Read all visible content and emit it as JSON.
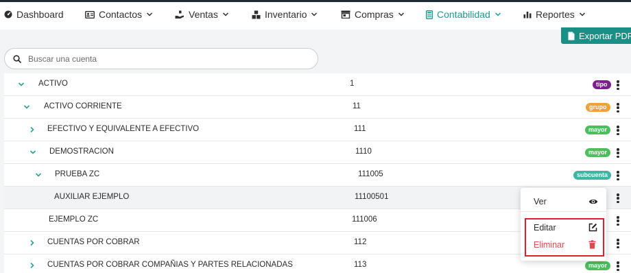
{
  "nav": {
    "items": [
      {
        "label": "Dashboard",
        "icon": "dashboard-icon",
        "has_menu": false,
        "active": false
      },
      {
        "label": "Contactos",
        "icon": "contacts-card-icon",
        "has_menu": true,
        "active": false
      },
      {
        "label": "Ventas",
        "icon": "sales-hand-icon",
        "has_menu": true,
        "active": false
      },
      {
        "label": "Inventario",
        "icon": "boxes-icon",
        "has_menu": true,
        "active": false
      },
      {
        "label": "Compras",
        "icon": "store-icon",
        "has_menu": true,
        "active": false
      },
      {
        "label": "Contabilidad",
        "icon": "calculator-icon",
        "has_menu": true,
        "active": true
      },
      {
        "label": "Reportes",
        "icon": "bar-chart-icon",
        "has_menu": true,
        "active": false
      }
    ]
  },
  "toolbar": {
    "export_label": "Exportar PDF",
    "search_placeholder": "Buscar una cuenta"
  },
  "accounts": [
    {
      "name": "ACTIVO",
      "code": "1",
      "badge": "tipo",
      "expandable": true,
      "expanded": true
    },
    {
      "name": "ACTIVO CORRIENTE",
      "code": "11",
      "badge": "grupo",
      "expandable": true,
      "expanded": true
    },
    {
      "name": "EFECTIVO Y EQUIVALENTE A EFECTIVO",
      "code": "111",
      "badge": "mayor",
      "expandable": true,
      "expanded": false
    },
    {
      "name": "DEMOSTRACION",
      "code": "1110",
      "badge": "mayor",
      "expandable": true,
      "expanded": true
    },
    {
      "name": "PRUEBA ZC",
      "code": "111005",
      "badge": "subcuenta",
      "expandable": true,
      "expanded": true
    },
    {
      "name": "AUXILIAR EJEMPLO",
      "code": "11100501",
      "badge": "",
      "expandable": false,
      "expanded": false
    },
    {
      "name": "EJEMPLO ZC",
      "code": "111006",
      "badge": "",
      "expandable": false,
      "expanded": false
    },
    {
      "name": "CUENTAS POR COBRAR",
      "code": "112",
      "badge": "",
      "expandable": true,
      "expanded": false
    },
    {
      "name": "CUENTAS POR COBRAR COMPAÑIAS Y PARTES RELACIONADAS",
      "code": "113",
      "badge": "mayor",
      "expandable": true,
      "expanded": false
    }
  ],
  "badge_colors": {
    "tipo": "#7b1f8c",
    "grupo": "#f0a23a",
    "mayor": "#4cbf5c",
    "subcuenta": "#3fb6a3"
  },
  "context_menu": {
    "view_label": "Ver",
    "edit_label": "Editar",
    "delete_label": "Eliminar",
    "delete_color": "#e5484d"
  },
  "colors": {
    "accent": "#1a9b8e",
    "caret": "#2a9d8f",
    "highlight": "#e11d2a"
  }
}
